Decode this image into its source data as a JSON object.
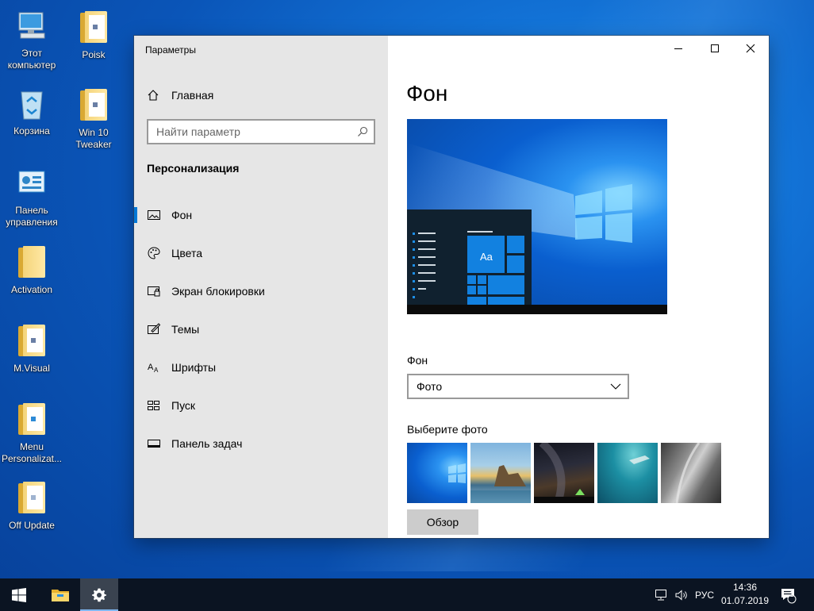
{
  "desktop": {
    "icons": [
      {
        "label": "Этот\nкомпьютер"
      },
      {
        "label": "Poisk"
      },
      {
        "label": "Корзина"
      },
      {
        "label": "Win 10\nTweaker"
      },
      {
        "label": "Панель\nуправления"
      },
      {
        "label": "Activation"
      },
      {
        "label": "M.Visual"
      },
      {
        "label": "Menu\nPersonalizat..."
      },
      {
        "label": "Off Update"
      }
    ]
  },
  "window": {
    "title": "Параметры",
    "controls": {
      "minimize": "minimize-icon",
      "maximize": "maximize-icon",
      "close": "close-icon"
    },
    "sidebar": {
      "home_label": "Главная",
      "search_placeholder": "Найти параметр",
      "section_title": "Персонализация",
      "items": [
        {
          "label": "Фон",
          "icon": "picture-icon",
          "active": true
        },
        {
          "label": "Цвета",
          "icon": "palette-icon"
        },
        {
          "label": "Экран блокировки",
          "icon": "lock-screen-icon"
        },
        {
          "label": "Темы",
          "icon": "themes-icon"
        },
        {
          "label": "Шрифты",
          "icon": "fonts-icon"
        },
        {
          "label": "Пуск",
          "icon": "start-icon"
        },
        {
          "label": "Панель задач",
          "icon": "taskbar-icon"
        }
      ]
    },
    "main": {
      "heading": "Фон",
      "preview_tile_text": "Aa",
      "background_label": "Фон",
      "background_value": "Фото",
      "choose_photo_label": "Выберите фото",
      "browse_label": "Обзор",
      "photos": [
        "windows-blue",
        "beach-rocks",
        "night-sky",
        "underwater",
        "rock-cliff"
      ]
    }
  },
  "taskbar": {
    "language": "РУС",
    "time": "14:36",
    "date": "01.07.2019",
    "notification_count": "1",
    "accent": "#0078d7"
  }
}
